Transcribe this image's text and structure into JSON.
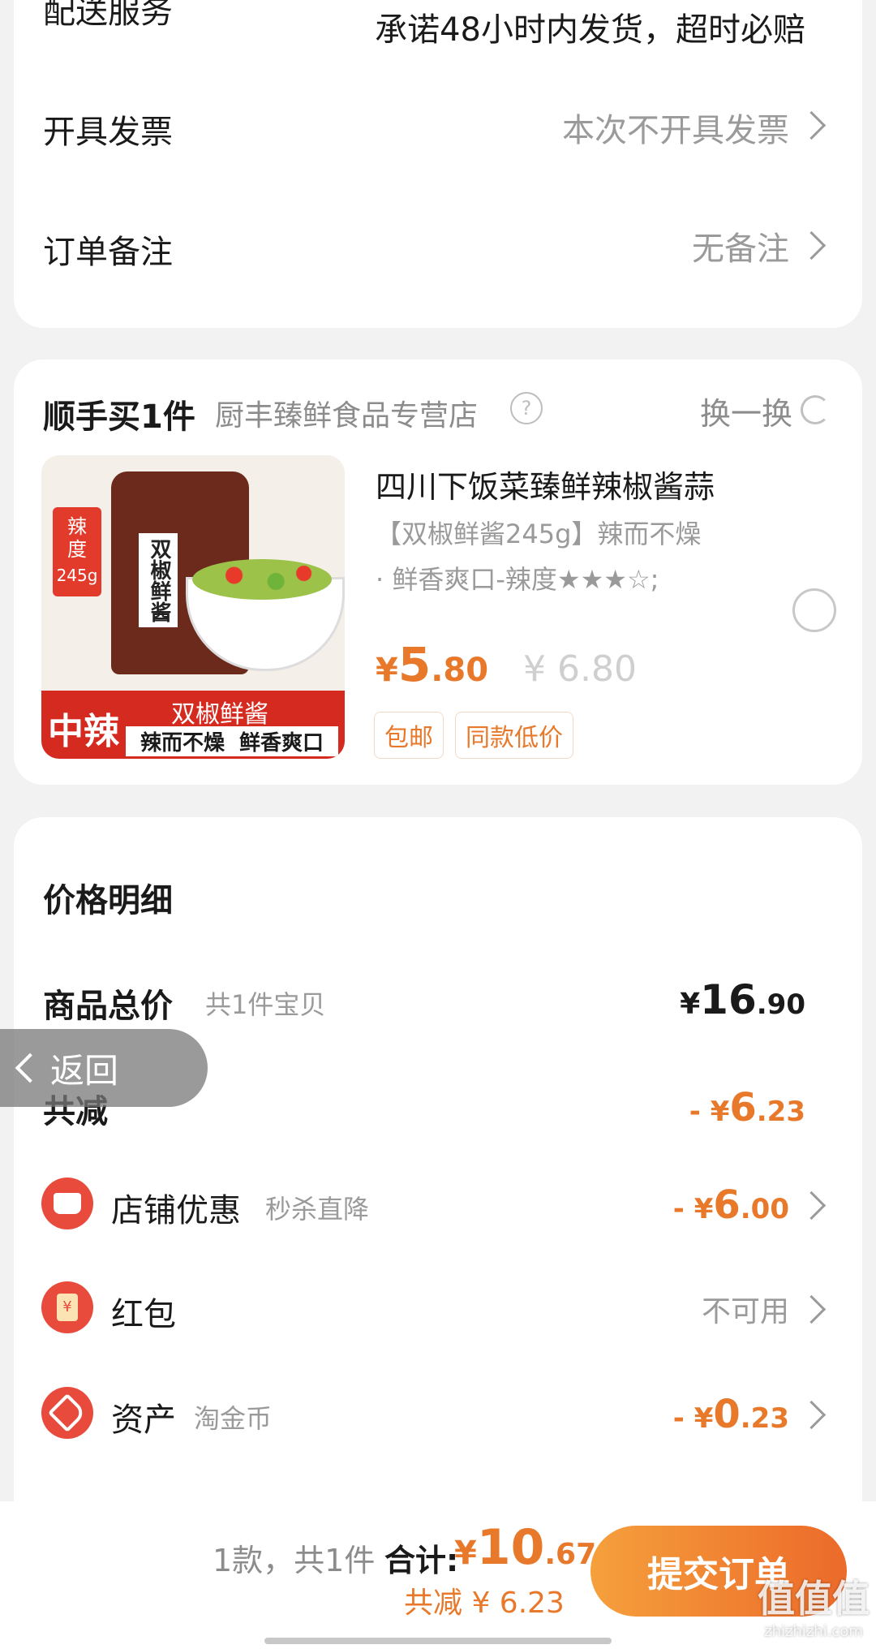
{
  "delivery": {
    "label_partial": "配送服务",
    "value": "承诺48小时内发货，超时必赔"
  },
  "invoice": {
    "label": "开具发票",
    "value": "本次不开具发票"
  },
  "order_note": {
    "label": "订单备注",
    "value": "无备注"
  },
  "addon": {
    "title": "顺手买1件",
    "store": "厨丰臻鲜食品专营店",
    "swap_label": "换一换",
    "product": {
      "name": "四川下饭菜臻鲜辣椒酱蒜",
      "desc_line1": "【双椒鲜酱245g】辣而不燥",
      "desc_line2": "· 鲜香爽口-辣度★★★☆;",
      "price_symbol": "¥",
      "price_int": "5",
      "price_dec": ".80",
      "orig_price": "¥ 6.80",
      "tags": [
        "包邮",
        "同款低价"
      ],
      "image_text": {
        "spice_badge": "辣度",
        "weight": "245g",
        "jar_label": "双椒鲜酱",
        "banner_left": "中辣",
        "banner_top": "双椒鲜酱",
        "banner_bottom": "辣而不燥  鲜香爽口"
      }
    }
  },
  "price_detail": {
    "title": "价格明细",
    "total": {
      "label": "商品总价",
      "sub": "共1件宝贝",
      "symbol": "¥",
      "int": "16",
      "dec": ".90"
    },
    "reduce": {
      "label": "共减",
      "prefix": "- ¥",
      "int": "6",
      "dec": ".23"
    },
    "items": [
      {
        "label": "店铺优惠",
        "sub": "秒杀直降",
        "prefix": "- ¥",
        "int": "6",
        "dec": ".00",
        "icon": "store-icon"
      },
      {
        "label": "红包",
        "sub": "",
        "value": "不可用",
        "icon": "red-packet-icon"
      },
      {
        "label": "资产",
        "sub": "淘金币",
        "prefix": "- ¥",
        "int": "0",
        "dec": ".23",
        "icon": "coin-tag-icon"
      }
    ]
  },
  "back_button": {
    "label": "返回"
  },
  "bottom_bar": {
    "count": "1款，共1件",
    "total_label": "合计:",
    "total_symbol": "¥",
    "total_int": "10",
    "total_dec": ".67",
    "reduce": "共减 ¥ 6.23",
    "submit": "提交订单"
  },
  "watermark": {
    "text": "值值值",
    "domain": "zhizhizhi.com"
  },
  "colors": {
    "accent": "#e8792b",
    "icon_red": "#e84a3c",
    "submit_gradient": [
      "#f5a03c",
      "#ec6a2a"
    ]
  }
}
